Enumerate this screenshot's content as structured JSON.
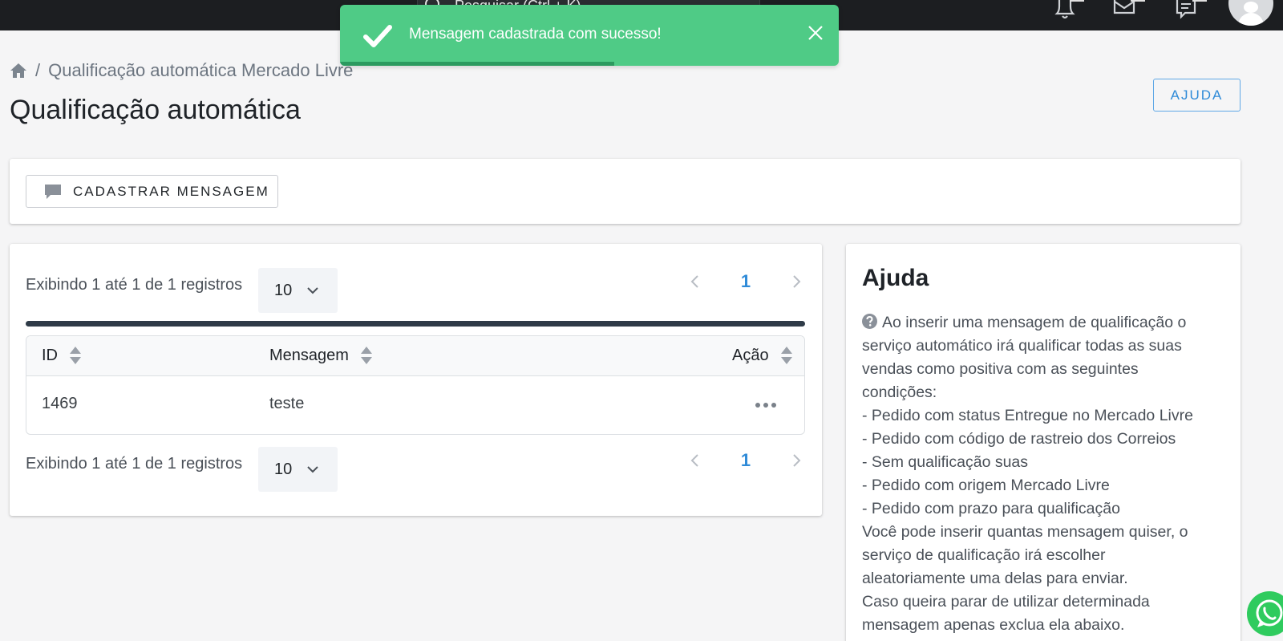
{
  "topbar": {
    "search_placeholder": "Pesquisar (Ctrl + K)",
    "icons": [
      "bell-icon",
      "mail-icon",
      "message-icon"
    ],
    "avatar": "user-avatar"
  },
  "toast": {
    "message": "Mensagem cadastrada com sucesso!",
    "progress": 0.55,
    "color": "#4fcb86"
  },
  "breadcrumb": {
    "separator": "/",
    "current": "Qualificação automática Mercado Livre"
  },
  "page": {
    "title": "Qualificação automática",
    "help_button": "AJUDA"
  },
  "actions": {
    "register_button": "CADASTRAR MENSAGEM"
  },
  "table_card": {
    "records_info_top": "Exibindo 1 até 1 de 1 registros",
    "records_info_bottom": "Exibindo 1 até 1 de 1 registros",
    "page_size": "10",
    "current_page": "1",
    "columns": [
      "ID",
      "Mensagem",
      "Ação"
    ],
    "rows": [
      {
        "id": "1469",
        "message": "teste"
      }
    ]
  },
  "help": {
    "title": "Ajuda",
    "lines": [
      "Ao inserir uma mensagem de qualificação o",
      "serviço automático irá qualificar todas as suas",
      "vendas como positiva com as seguintes",
      "condições:",
      "- Pedido com status Entregue no Mercado Livre",
      "- Pedido com código de rastreio dos Correios",
      "- Sem qualificação suas",
      "- Pedido com origem Mercado Livre",
      "- Pedido com prazo para qualificação",
      "Você pode inserir quantas mensagem quiser, o",
      "serviço de qualificação irá escolher",
      "aleatoriamente uma delas para enviar.",
      "Caso queira parar de utilizar determinada",
      "mensagem apenas exclua ela abaixo."
    ]
  },
  "colors": {
    "accent": "#2f8bd8",
    "topbar": "#1c1e21",
    "success": "#4fcb86",
    "whatsapp": "#2fcb5e"
  }
}
